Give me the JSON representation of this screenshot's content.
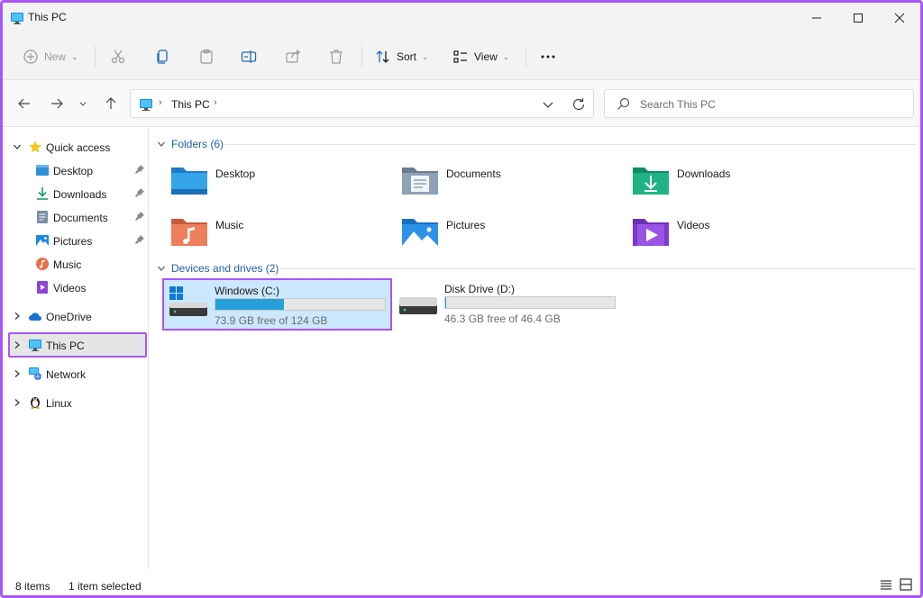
{
  "window": {
    "title": "This PC",
    "accent": "#a855f7"
  },
  "toolbar": {
    "new_label": "New",
    "sort_label": "Sort",
    "view_label": "View",
    "icons": [
      "add-icon",
      "cut-icon",
      "copy-icon",
      "paste-icon",
      "rename-icon",
      "share-icon",
      "delete-icon",
      "sort-icon",
      "view-icon",
      "more-icon"
    ]
  },
  "address": {
    "crumb": "This PC",
    "search_placeholder": "Search This PC"
  },
  "sidebar": {
    "quick_access": "Quick access",
    "quick_items": [
      {
        "label": "Desktop",
        "icon": "desktop-icon"
      },
      {
        "label": "Downloads",
        "icon": "downloads-icon"
      },
      {
        "label": "Documents",
        "icon": "documents-icon"
      },
      {
        "label": "Pictures",
        "icon": "pictures-icon"
      },
      {
        "label": "Music",
        "icon": "music-icon"
      },
      {
        "label": "Videos",
        "icon": "videos-icon"
      }
    ],
    "onedrive": "OneDrive",
    "this_pc": "This PC",
    "network": "Network",
    "linux": "Linux"
  },
  "main": {
    "folders_header": "Folders (6)",
    "folders": [
      {
        "name": "Desktop",
        "icon": "desktop-folder-icon"
      },
      {
        "name": "Documents",
        "icon": "documents-folder-icon"
      },
      {
        "name": "Downloads",
        "icon": "downloads-folder-icon"
      },
      {
        "name": "Music",
        "icon": "music-folder-icon"
      },
      {
        "name": "Pictures",
        "icon": "pictures-folder-icon"
      },
      {
        "name": "Videos",
        "icon": "videos-folder-icon"
      }
    ],
    "drives_header": "Devices and drives (2)",
    "drives": [
      {
        "name": "Windows (C:)",
        "free": "73.9 GB free of 124 GB",
        "used_fraction": 0.404
      },
      {
        "name": "Disk Drive (D:)",
        "free": "46.3 GB free of 46.4 GB",
        "used_fraction": 0.002
      }
    ]
  },
  "status": {
    "items": "8 items",
    "selected": "1 item selected"
  }
}
